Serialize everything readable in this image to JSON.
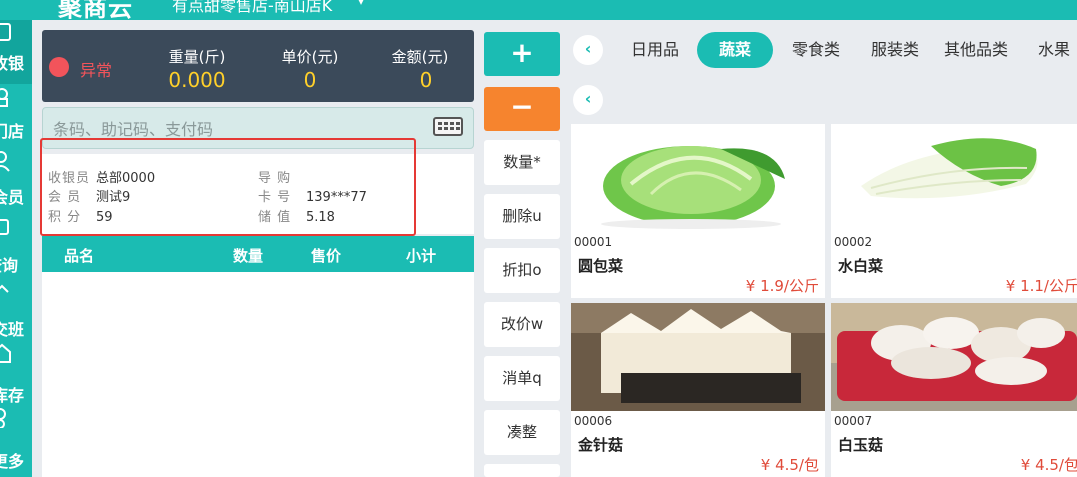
{
  "app": {
    "logo": "聚商云",
    "store": "有点甜零售店-南山店K"
  },
  "nav": {
    "items": [
      {
        "label": "收银",
        "icon": "checkout-icon"
      },
      {
        "label": "门店",
        "icon": "store-icon"
      },
      {
        "label": "会员",
        "icon": "member-icon"
      },
      {
        "label": "查询",
        "icon": "search-query-icon"
      },
      {
        "label": "交班",
        "icon": "shift-icon"
      },
      {
        "label": "库存",
        "icon": "inventory-icon"
      },
      {
        "label": "更多",
        "icon": "more-icon"
      }
    ]
  },
  "scale": {
    "status": "异常",
    "status_color": "#f2545b",
    "weight_label": "重量(斤)",
    "weight_value": "0.000",
    "unit_price_label": "单价(元)",
    "unit_price_value": "0",
    "amount_label": "金额(元)",
    "amount_value": "0"
  },
  "search": {
    "placeholder": "条码、助记码、支付码"
  },
  "info": {
    "cashier_key": "收银员",
    "cashier_value": "总部0000",
    "guide_key": "导 购",
    "guide_value": "",
    "member_key": "会 员",
    "member_value": "测试9",
    "card_key": "卡 号",
    "card_value": "139***77",
    "points_key": "积 分",
    "points_value": "59",
    "balance_key": "储 值",
    "balance_value": "5.18"
  },
  "cart": {
    "col_name": "品名",
    "col_qty": "数量",
    "col_price": "售价",
    "col_subtotal": "小计"
  },
  "actions": {
    "plus": "+",
    "minus": "−",
    "quantity": "数量*",
    "delete": "删除u",
    "discount": "折扣o",
    "change_price": "改价w",
    "cancel": "消单q",
    "round": "凑整"
  },
  "categories": {
    "tabs": [
      "日用品",
      "蔬菜",
      "零食类",
      "服装类",
      "其他品类",
      "水果"
    ],
    "active": "蔬菜"
  },
  "products": [
    {
      "code": "00001",
      "name": "圆包菜",
      "price": "¥ 1.9/公斤",
      "image": "cabbage-image"
    },
    {
      "code": "00002",
      "name": "水白菜",
      "price": "¥ 1.1/公斤",
      "image": "napa-cabbage-image"
    },
    {
      "code": "00006",
      "name": "金针菇",
      "price": "¥ 4.5/包",
      "image": "enoki-image"
    },
    {
      "code": "00007",
      "name": "白玉菇",
      "price": "¥ 4.5/包",
      "image": "white-mushroom-image"
    }
  ],
  "colors": {
    "primary": "#1bbcb3",
    "accent": "#f6842e",
    "dark_panel": "#3b4a5a",
    "price": "#e04b3a",
    "value": "#ffd02a"
  }
}
